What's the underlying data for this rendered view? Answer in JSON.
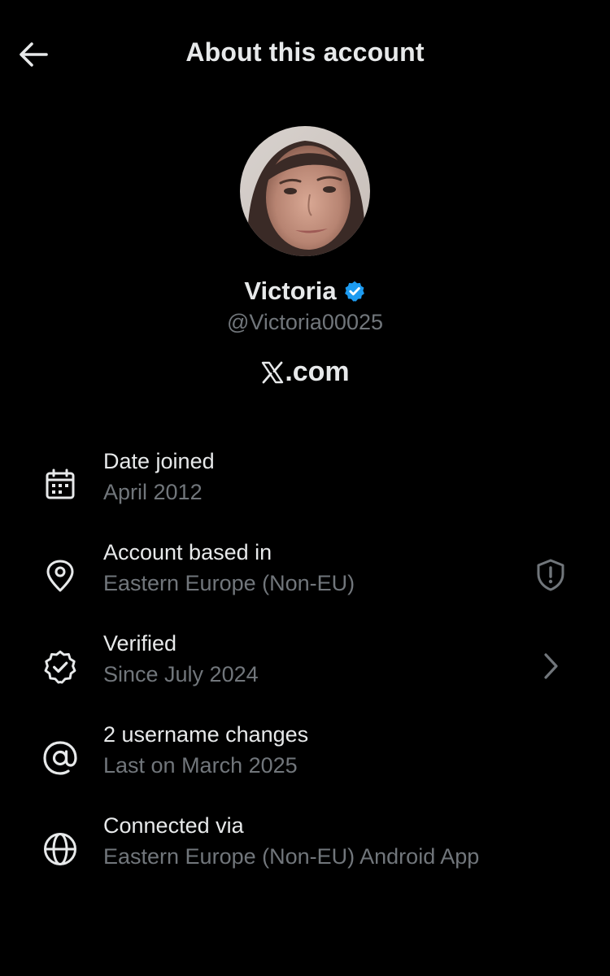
{
  "header": {
    "title": "About this account",
    "back_icon": "arrow-left-icon"
  },
  "profile": {
    "name": "Victoria",
    "verified_badge": "verified-badge-icon",
    "verified_color": "#1d9bf0",
    "handle": "@Victoria00025",
    "site": ".com",
    "site_logo": "x-logo-icon"
  },
  "info_items": [
    {
      "icon": "calendar-icon",
      "title": "Date joined",
      "subtitle": "April 2012"
    },
    {
      "icon": "location-pin-icon",
      "title": "Account based in",
      "subtitle": "Eastern Europe (Non-EU)",
      "trailing_icon": "shield-alert-icon"
    },
    {
      "icon": "verified-seal-icon",
      "title": "Verified",
      "subtitle": "Since July 2024",
      "trailing_icon": "chevron-right-icon"
    },
    {
      "icon": "at-sign-icon",
      "title": "2 username changes",
      "subtitle": "Last on March 2025"
    },
    {
      "icon": "globe-icon",
      "title": "Connected via",
      "subtitle": "Eastern Europe (Non-EU) Android App"
    }
  ],
  "colors": {
    "background": "#000000",
    "primary_text": "#e7e9ea",
    "secondary_text": "#71767b",
    "accent": "#1d9bf0"
  }
}
